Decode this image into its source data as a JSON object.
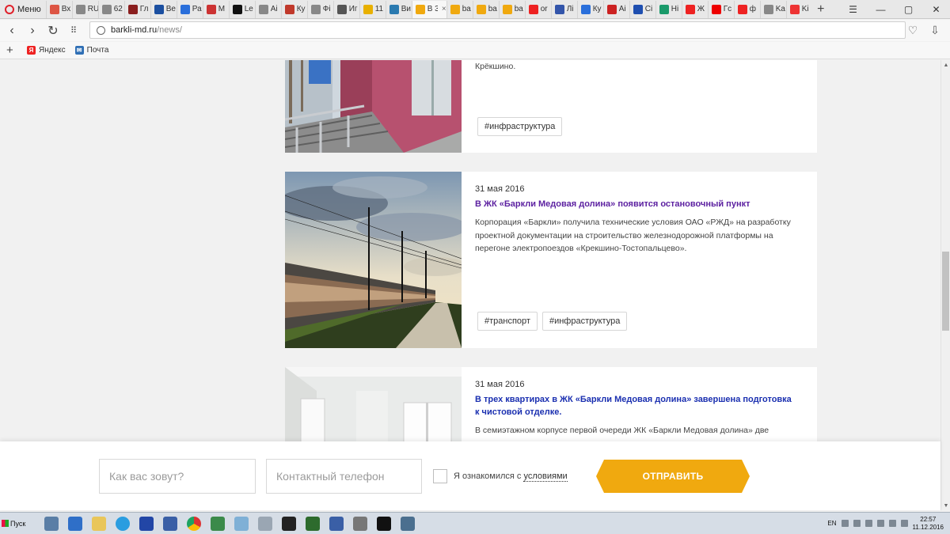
{
  "browser": {
    "menu_label": "Меню",
    "tabs": [
      {
        "label": "Вх",
        "icon": "gmail-icon",
        "color": "#d54"
      },
      {
        "label": "RU",
        "icon": "page-icon",
        "color": "#888"
      },
      {
        "label": "62",
        "icon": "page-icon",
        "color": "#888"
      },
      {
        "label": "Гл",
        "icon": "letter-icon",
        "color": "#8a1e1e"
      },
      {
        "label": "Ве",
        "icon": "bi-icon",
        "color": "#1b4fa0"
      },
      {
        "label": "Ра",
        "icon": "slash-icon",
        "color": "#2a6fdb"
      },
      {
        "label": "M",
        "icon": "mail-icon",
        "color": "#c33"
      },
      {
        "label": "Le",
        "icon": "l-icon",
        "color": "#111"
      },
      {
        "label": "Ai",
        "icon": "page-icon",
        "color": "#888"
      },
      {
        "label": "Кy",
        "icon": "kinopoisk-icon",
        "color": "#c0392b"
      },
      {
        "label": "Фі",
        "icon": "page-icon",
        "color": "#888"
      },
      {
        "label": "Иг",
        "icon": "history-icon",
        "color": "#555"
      },
      {
        "label": "11",
        "icon": "envelope-icon",
        "color": "#e8b000"
      },
      {
        "label": "Ви",
        "icon": "yandex-icon",
        "color": "#2a7ab0"
      }
    ],
    "active_tab": {
      "label": "В 3",
      "icon": "barkli-icon",
      "color": "#f0a90f"
    },
    "tabs_after": [
      {
        "label": "ba",
        "icon": "barkli-icon",
        "color": "#f0a90f"
      },
      {
        "label": "ba",
        "icon": "barkli-icon",
        "color": "#f0a90f"
      },
      {
        "label": "ba",
        "icon": "barkli-icon",
        "color": "#f0a90f"
      },
      {
        "label": "or",
        "icon": "yandex-icon",
        "color": "#e22"
      },
      {
        "label": "Лі",
        "icon": "page-icon",
        "color": "#3355aa"
      },
      {
        "label": "Ку",
        "icon": "snowflake-icon",
        "color": "#2a6fdb"
      },
      {
        "label": "Аі",
        "icon": "page-icon",
        "color": "#c22"
      },
      {
        "label": "Сі",
        "icon": "russia-icon",
        "color": "#1f4fb0"
      },
      {
        "label": "Ні",
        "icon": "n-icon",
        "color": "#1a9a6a"
      },
      {
        "label": "Ж",
        "icon": "r-icon",
        "color": "#e22"
      },
      {
        "label": "Гс",
        "icon": "youtube-icon",
        "color": "#e00"
      },
      {
        "label": "ф",
        "icon": "yandex-icon",
        "color": "#e22"
      },
      {
        "label": "Ka",
        "icon": "page-icon",
        "color": "#888"
      },
      {
        "label": "Ki",
        "icon": "red-dot-icon",
        "color": "#e33"
      }
    ],
    "url_host": "barkli-md.ru",
    "url_path": "/news/",
    "bookmarks": [
      {
        "label": "Яндекс",
        "icon": "yandex-icon"
      },
      {
        "label": "Почта",
        "icon": "mail-icon"
      }
    ]
  },
  "news": [
    {
      "date": "",
      "title": "",
      "text": "Крёкшино.",
      "tags": [
        "#инфраструктура"
      ]
    },
    {
      "date": "31 мая 2016",
      "title": "В ЖК «Баркли Медовая долина» появится остановочный пункт",
      "title_color": "#5b1fa0",
      "text": "Корпорация «Баркли» получила технические условия ОАО «РЖД» на разработку проектной документации на строительство железнодорожной платформы на перегоне электропоездов «Крекшино-Тостопальцево».",
      "tags": [
        "#транспорт",
        "#инфраструктура"
      ]
    },
    {
      "date": "31 мая 2016",
      "title": "В трех квартирах в ЖК «Баркли Медовая долина» завершена подготовка к чистовой отделке.",
      "title_color": "#1a2fb0",
      "text": "В семиэтажном корпусе первой очереди ЖК «Баркли Медовая долина» две",
      "tags": []
    }
  ],
  "form": {
    "name_placeholder": "Как вас зовут?",
    "phone_placeholder": "Контактный телефон",
    "consent_text": "Я ознакомился с",
    "consent_link": "условиями",
    "submit_label": "ОТПРАВИТЬ",
    "accent": "#f0a90f"
  },
  "taskbar": {
    "start_label": "Пуск",
    "lang": "EN",
    "time": "22:57",
    "date": "11.12.2016"
  }
}
